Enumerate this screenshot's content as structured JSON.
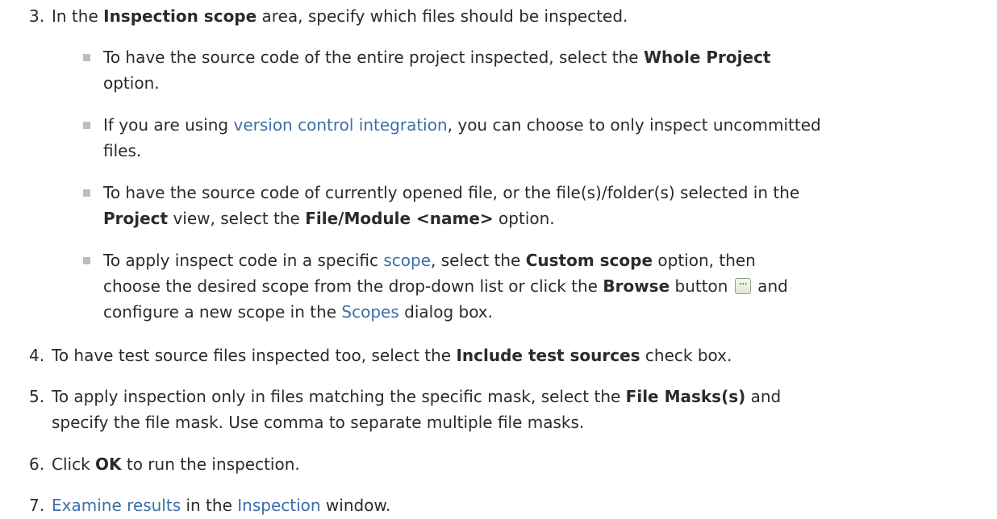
{
  "steps": {
    "s3": {
      "num": "3.",
      "t1": "In the ",
      "b1": "Inspection scope",
      "t2": " area, specify which files should be inspected."
    },
    "bullets": {
      "b1": {
        "l1a": "To have the source code of the entire project inspected, select the ",
        "l1b": "Whole Project",
        "l2": "option."
      },
      "b2": {
        "l1a": "If you are using ",
        "link": "version control integration",
        "l1b": ", you can choose to only inspect uncommitted",
        "l2": "files."
      },
      "b3": {
        "l1": "To have the source code of currently opened file, or the file(s)/folder(s) selected in the",
        "l2a": "Project",
        "l2b": " view, select the ",
        "l2c": "File/Module <name>",
        "l2d": " option."
      },
      "b4": {
        "l1a": "To apply inspect code in a specific ",
        "link1": "scope",
        "l1b": ", select the ",
        "l1c": "Custom scope",
        "l1d": " option, then",
        "l2a": "choose the desired scope from the drop-down list or click the ",
        "l2b": "Browse",
        "l2c": " button ",
        "btn": "...",
        "l2d": " and",
        "l3a": "configure a new scope in the ",
        "link2": "Scopes",
        "l3b": " dialog box."
      }
    },
    "s4": {
      "num": "4.",
      "t1": "To have test source files inspected too, select the ",
      "b1": "Include test sources",
      "t2": " check box."
    },
    "s5": {
      "num": "5.",
      "t1": "To apply inspection only in files matching the specific mask, select the ",
      "b1": "File Masks(s)",
      "t2": " and",
      "l2": "specify the file mask. Use comma to separate multiple file masks."
    },
    "s6": {
      "num": "6.",
      "t1": "Click ",
      "b1": "OK",
      "t2": " to run the inspection."
    },
    "s7": {
      "num": "7.",
      "link1": "Examine results",
      "t1": " in the ",
      "link2": "Inspection",
      "t2": " window."
    }
  },
  "colors": {
    "text": "#2b2b2b",
    "link": "#3d6ea8",
    "bullet": "#bdbdbd"
  },
  "icons": {
    "browse": "ellipsis-button-icon"
  }
}
